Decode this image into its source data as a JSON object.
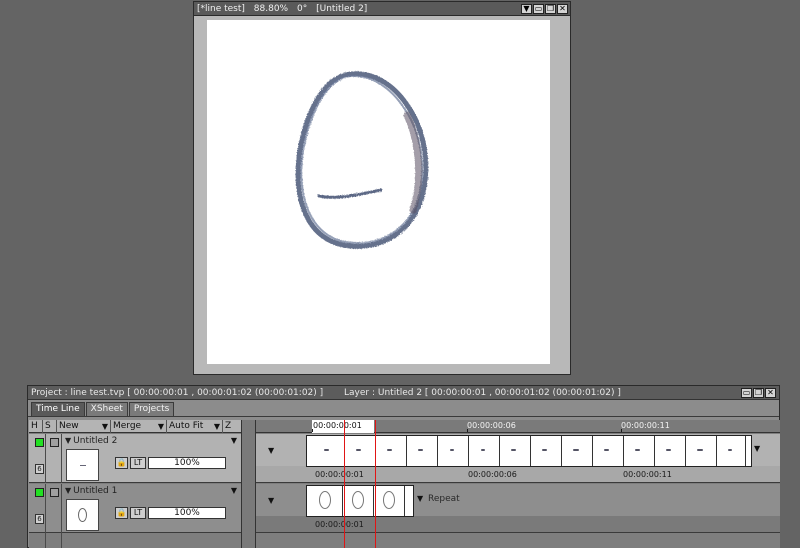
{
  "canvas_window": {
    "title_project": "[*line test]",
    "title_zoom": "88.80%",
    "title_angle": "0°",
    "title_layer": "[Untitled 2]",
    "buttons": [
      "▼",
      "▭",
      "❐",
      "✕"
    ]
  },
  "timeline_panel": {
    "project_info": "Project : line test.tvp [ 00:00:00:01 , 00:00:01:02  (00:00:01:02) ]",
    "layer_info": "Layer : Untitled 2 [ 00:00:00:01 , 00:00:01:02  (00:00:01:02) ]",
    "window_buttons": [
      "▭",
      "❐",
      "✕"
    ],
    "tabs": [
      "Time Line",
      "XSheet",
      "Projects"
    ],
    "list_header": {
      "h": "H",
      "s": "S",
      "new": "New",
      "merge": "Merge",
      "auto_fit": "Auto Fit",
      "z": "Z"
    },
    "layers": [
      {
        "name": "Untitled 2",
        "opacity": "100%",
        "lock": "🔒",
        "lt": "LT",
        "number": "6"
      },
      {
        "name": "Untitled 1",
        "opacity": "100%",
        "lock": "🔒",
        "lt": "LT",
        "number": "6"
      }
    ],
    "ruler": {
      "cursor_label": "00:00:00:01",
      "label_2": "00:00:00:06",
      "label_3": "00:00:00:11"
    },
    "tracks": [
      {
        "times": [
          "00:00:00:01",
          "00:00:00:06",
          "00:00:00:11"
        ]
      },
      {
        "times": [
          "00:00:00:01"
        ],
        "repeat_label": "Repeat"
      }
    ]
  },
  "colors": {
    "background": "#646464",
    "stroke": "#4a5878",
    "visibility_on": "#22e022",
    "playhead": "#e01515"
  }
}
